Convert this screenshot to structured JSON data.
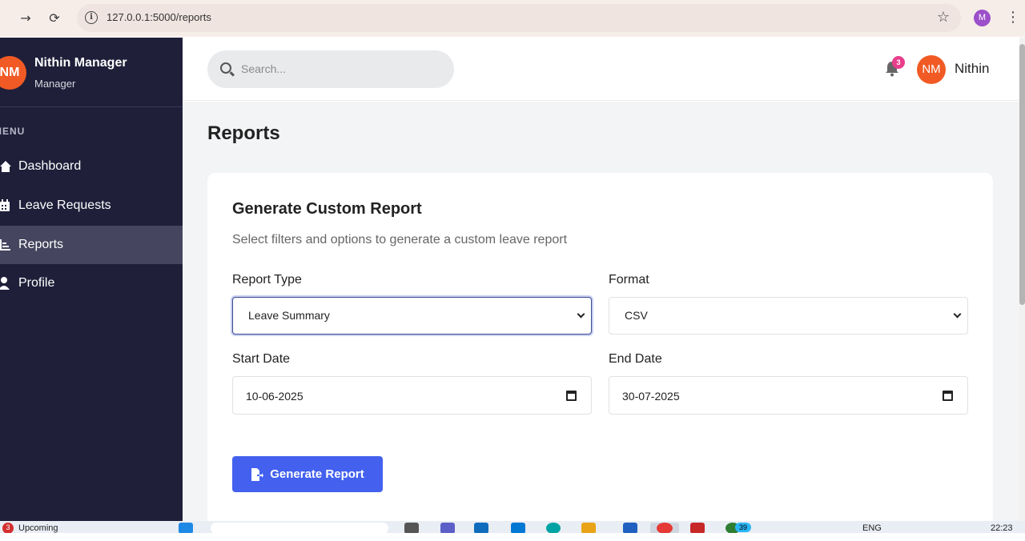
{
  "browser": {
    "url": "127.0.0.1:5000/reports",
    "profile_initial": "M"
  },
  "sidebar": {
    "avatar_initials": "NM",
    "user_name": "Nithin Manager",
    "user_role": "Manager",
    "menu_label": "MENU",
    "items": [
      {
        "label": "Dashboard",
        "icon": "home-icon",
        "active": false
      },
      {
        "label": "Leave Requests",
        "icon": "calendar-icon",
        "active": false
      },
      {
        "label": "Reports",
        "icon": "report-icon",
        "active": true
      },
      {
        "label": "Profile",
        "icon": "user-icon",
        "active": false
      }
    ]
  },
  "header": {
    "search_placeholder": "Search...",
    "notification_count": "3",
    "avatar_initials": "NM",
    "user_name": "Nithin"
  },
  "main": {
    "page_title": "Reports",
    "card": {
      "title": "Generate Custom Report",
      "subtitle": "Select filters and options to generate a custom leave report",
      "report_type_label": "Report Type",
      "report_type_value": "Leave Summary",
      "format_label": "Format",
      "format_value": "CSV",
      "start_date_label": "Start Date",
      "start_date_value": "10-06-2025",
      "end_date_label": "End Date",
      "end_date_value": "30-07-2025",
      "generate_button": "Generate Report"
    }
  },
  "taskbar": {
    "weather_badge": "3",
    "weather_text": "Upcoming",
    "language": "ENG",
    "time": "22:23",
    "app_badge": "39"
  },
  "colors": {
    "sidebar_bg": "#1f1f3a",
    "accent": "#4361ee",
    "avatar": "#f15a24",
    "badge": "#e83e8c"
  }
}
